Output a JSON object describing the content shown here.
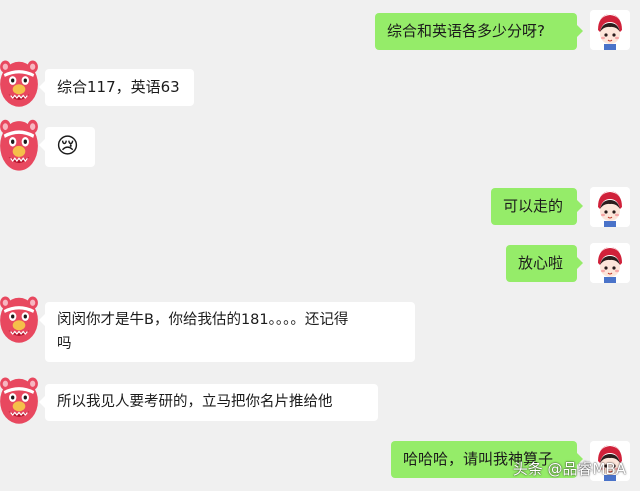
{
  "messages": [
    {
      "side": "right",
      "text": "综合和英语各多少分呀?"
    },
    {
      "side": "left",
      "text": "综合117，英语63"
    },
    {
      "side": "left",
      "emoji": "😢"
    },
    {
      "side": "right",
      "text": "可以走的"
    },
    {
      "side": "right",
      "text": "放心啦"
    },
    {
      "side": "left",
      "text_line1": "闵闵你才是牛B，你给我估的181。。。。还记得",
      "text_line2": "吗"
    },
    {
      "side": "left",
      "text": "所以我见人要考研的，立马把你名片推给他"
    },
    {
      "side": "right",
      "text": "哈哈哈，请叫我神算子"
    }
  ],
  "watermark": "头条 @品睿MBA",
  "colors": {
    "right_bubble": "#95ec69",
    "left_bubble": "#ffffff",
    "background": "#f0f0f0"
  }
}
